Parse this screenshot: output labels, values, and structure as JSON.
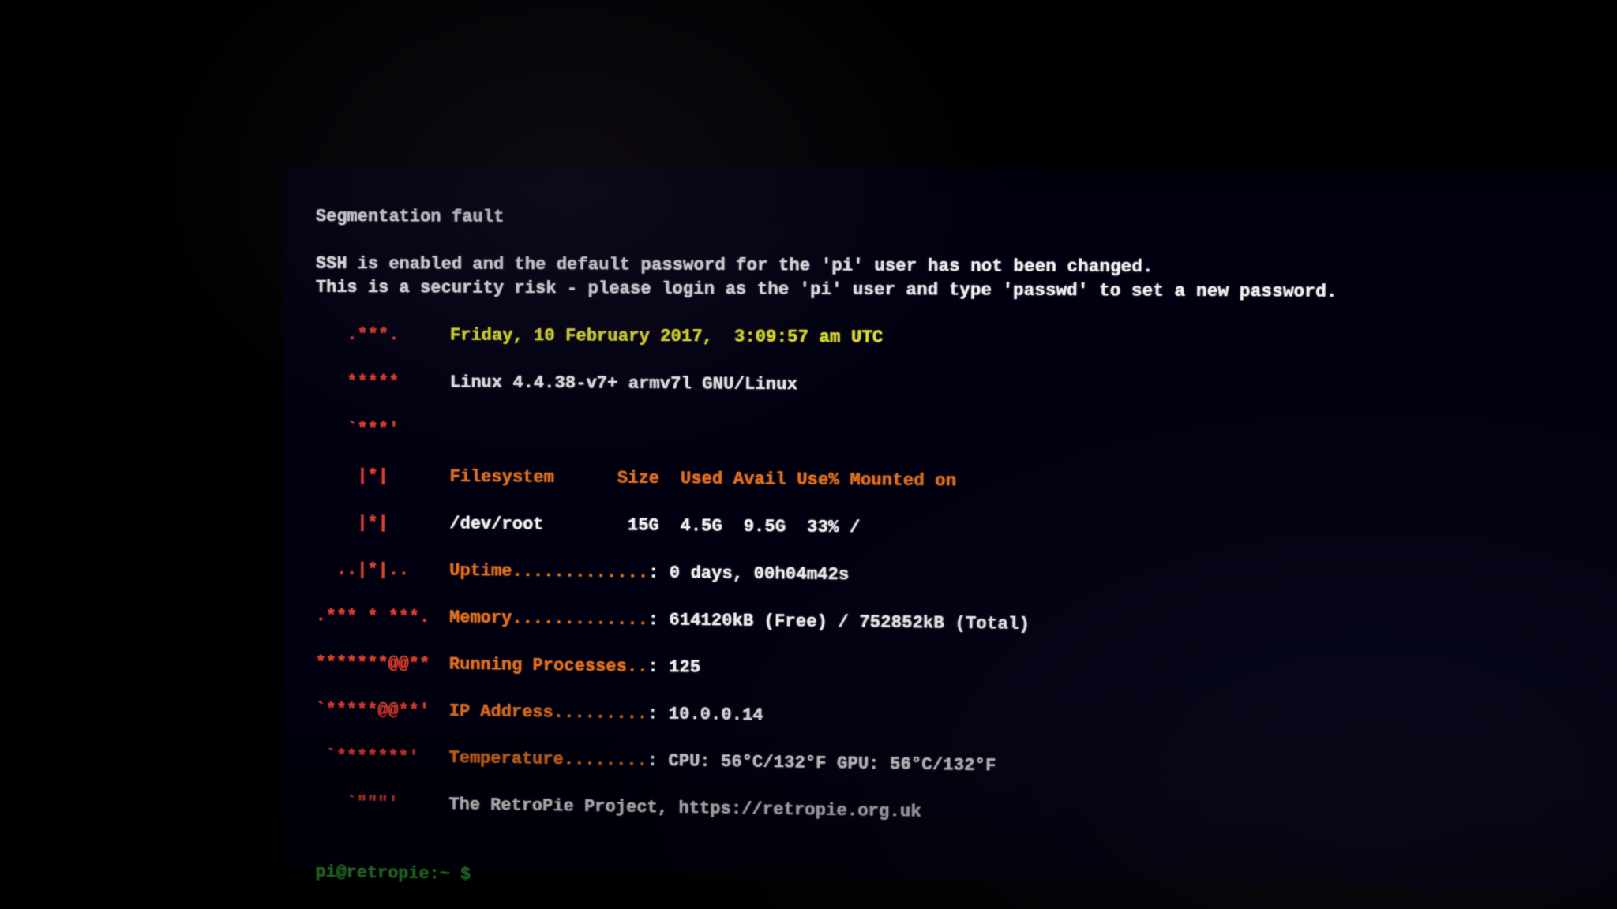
{
  "segfault": "Segmentation fault",
  "ssh_warn_l1": "SSH is enabled and the default password for the 'pi' user has not been changed.",
  "ssh_warn_l2": "This is a security risk - please login as the 'pi' user and type 'passwd' to set a new password.",
  "datetime": "Friday, 10 February 2017,  3:09:57 am UTC",
  "kernel": "Linux 4.4.38-v7+ armv7l GNU/Linux",
  "fs_header": "Filesystem      Size  Used Avail Use% Mounted on",
  "fs_row": "/dev/root        15G  4.5G  9.5G  33% /",
  "uptime_label": "Uptime.............",
  "uptime_value": "0 days, 00h04m42s",
  "memory_label": "Memory.............",
  "memory_value": "614120kB (Free) / 752852kB (Total)",
  "procs_label": "Running Processes..",
  "procs_value": "125",
  "ip_label": "IP Address.........",
  "ip_value": "10.0.0.14",
  "temp_label": "Temperature........",
  "temp_value": "CPU: 56°C/132°F GPU: 56°C/132°F",
  "project_line": "The RetroPie Project, https://retropie.org.uk",
  "prompt": "pi@retropie:~ $ ",
  "ascii": {
    "l1": "   .***.   ",
    "l2": "   *****   ",
    "l3": "   `***'   ",
    "l4": "    |*|    ",
    "l5": "    |*|    ",
    "l6": "  ..|*|..  ",
    "l7": ".*** * ***.",
    "l8": "*******@@**",
    "l9": "`*****@@**'",
    "l10": " `*******' ",
    "l11": "   `\"\"\"'   "
  }
}
